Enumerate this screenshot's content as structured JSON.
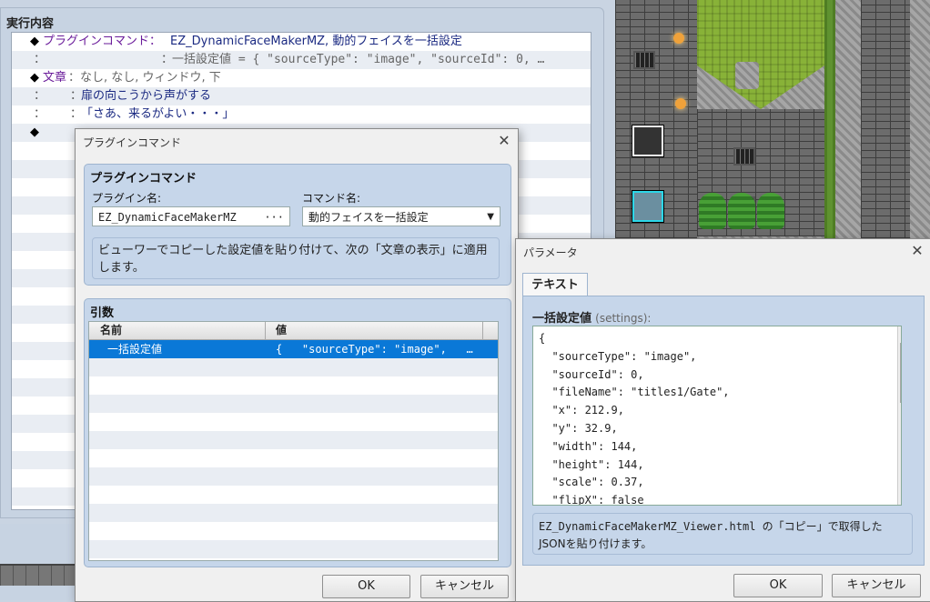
{
  "editor": {
    "title": "実行内容",
    "rows": [
      {
        "marker": "◆",
        "prefix": "プラグインコマンド：",
        "text": "EZ_DynamicFaceMakerMZ, 動的フェイスを一括設定",
        "style": "navy"
      },
      {
        "marker": "：",
        "prefix": "：",
        "text": "一括設定値 = {   \"sourceType\": \"image\",   \"sourceId\": 0,   …",
        "style": "gray"
      },
      {
        "marker": "◆",
        "prefix": "文章",
        "text": "：なし, なし, ウィンドウ, 下",
        "style": "gray"
      },
      {
        "marker": "：",
        "prefix": "：",
        "text": "扉の向こうから声がする",
        "style": "navy"
      },
      {
        "marker": "：",
        "prefix": "：",
        "text": "「さあ、来るがよい・・・」",
        "style": "navy"
      },
      {
        "marker": "◆",
        "prefix": "",
        "text": "",
        "style": "navy"
      }
    ]
  },
  "plugin_dialog": {
    "title": "プラグインコマンド",
    "close_icon": "close-icon",
    "group_title": "プラグインコマンド",
    "plugin_name_label": "プラグイン名:",
    "plugin_name_value": "EZ_DynamicFaceMakerMZ",
    "plugin_name_dots": "···",
    "command_name_label": "コマンド名:",
    "command_name_value": "動的フェイスを一括設定",
    "command_arrow": "▼",
    "description": "ビューワーでコピーした設定値を貼り付けて、次の「文章の表示」に適用します。",
    "args_title": "引数",
    "args_headers": {
      "name": "名前",
      "value": "値"
    },
    "args_rows": [
      {
        "name": "一括設定値",
        "value": "{   \"sourceType\": \"image\",   …"
      }
    ],
    "ok_label": "OK",
    "cancel_label": "キャンセル"
  },
  "param_dialog": {
    "title": "パラメータ",
    "close_icon": "close-icon",
    "tab_label": "テキスト",
    "field_label_main": "一括設定値",
    "field_label_sub": "(settings):",
    "json_text": "{\n  \"sourceType\": \"image\",\n  \"sourceId\": 0,\n  \"fileName\": \"titles1/Gate\",\n  \"x\": 212.9,\n  \"y\": 32.9,\n  \"width\": 144,\n  \"height\": 144,\n  \"scale\": 0.37,\n  \"flipX\": false",
    "scroll_up": "▲",
    "scroll_down": "▼",
    "help_text_line1": "EZ_DynamicFaceMakerMZ_Viewer.html の「コピー」で取得した",
    "help_text_line2": "JSONを貼り付けます。",
    "ok_label": "OK",
    "cancel_label": "キャンセル"
  },
  "colors": {
    "selection": "#0a78d7",
    "command_text": "#1b2a82",
    "panel_blue": "#c6d6ea"
  }
}
